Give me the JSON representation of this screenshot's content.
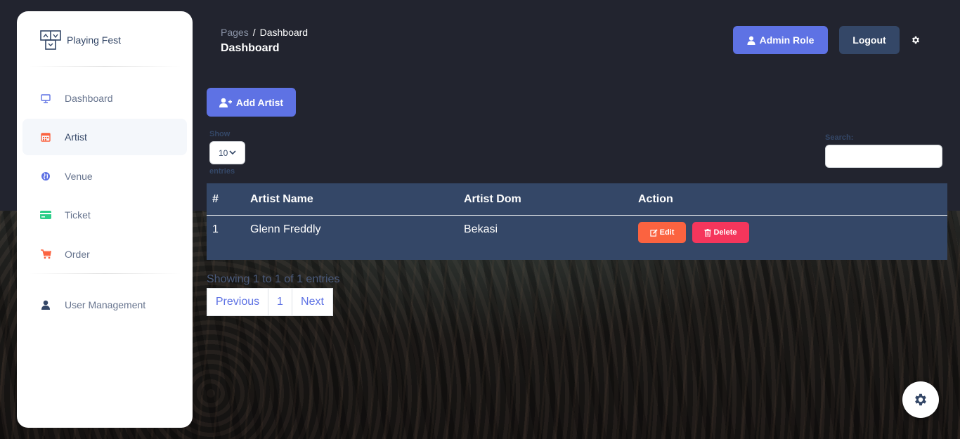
{
  "brand": {
    "name": "Playing Fest"
  },
  "sidebar": {
    "items": [
      {
        "label": "Dashboard",
        "icon": "monitor-icon",
        "color": "#5e72e4"
      },
      {
        "label": "Artist",
        "icon": "calendar-icon",
        "color": "#fb6340",
        "active": true
      },
      {
        "label": "Venue",
        "icon": "globe-icon",
        "color": "#5e72e4"
      },
      {
        "label": "Ticket",
        "icon": "credit-card-icon",
        "color": "#2dce89"
      },
      {
        "label": "Order",
        "icon": "cart-icon",
        "color": "#fb6340"
      },
      {
        "label": "User Management",
        "icon": "user-icon",
        "color": "#344767"
      }
    ]
  },
  "header": {
    "breadcrumb_parent": "Pages",
    "breadcrumb_separator": "/",
    "breadcrumb_current": "Dashboard",
    "title": "Dashboard",
    "admin_label": "Admin Role",
    "logout_label": "Logout"
  },
  "toolbar": {
    "add_label": "Add Artist"
  },
  "datatable": {
    "show_label": "Show",
    "length_value": "10",
    "entries_label": "entries",
    "search_label": "Search:",
    "search_value": "",
    "columns": [
      "#",
      "Artist Name",
      "Artist Dom",
      "Action"
    ],
    "rows": [
      {
        "no": "1",
        "name": "Glenn Freddly",
        "dom": "Bekasi"
      }
    ],
    "edit_label": "Edit",
    "delete_label": "Delete",
    "info": "Showing 1 to 1 of 1 entries",
    "pagination": {
      "previous": "Previous",
      "page": "1",
      "next": "Next"
    }
  },
  "colors": {
    "primary": "#5e72e4",
    "dark": "#344767",
    "warning": "#fb6340",
    "danger": "#f5365c",
    "background": "#22242f"
  }
}
